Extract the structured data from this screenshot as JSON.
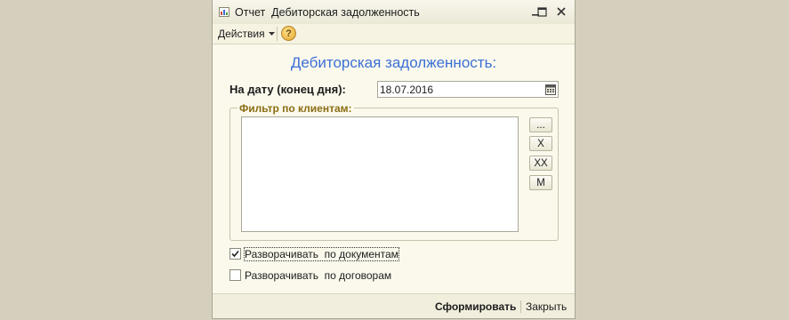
{
  "window": {
    "title": "Отчет  Дебиторская задолженность"
  },
  "toolbar": {
    "actions_label": "Действия",
    "help_label": "?"
  },
  "form": {
    "heading": "Дебиторская задолженность:",
    "date_label": "На дату (конец дня):",
    "date_value": "18.07.2016",
    "filter_group_label": "Фильтр по клиентам:",
    "filter_items": [],
    "side_buttons": [
      {
        "label": "...",
        "name": "select-clients-button"
      },
      {
        "label": "X",
        "name": "clear-selected-button"
      },
      {
        "label": "XX",
        "name": "clear-all-button"
      },
      {
        "label": "M",
        "name": "m-button"
      }
    ],
    "checkbox_documents": {
      "label": "Разворачивать  по документам",
      "checked": true
    },
    "checkbox_contracts": {
      "label": "Разворачивать  по договорам",
      "checked": false
    }
  },
  "footer": {
    "generate_label": "Сформировать",
    "close_label": "Закрыть"
  },
  "colors": {
    "heading": "#3d6fd6",
    "group_label": "#8a6d12",
    "window_bg": "#fbf9ec",
    "desktop_bg": "#d4d0bd"
  }
}
